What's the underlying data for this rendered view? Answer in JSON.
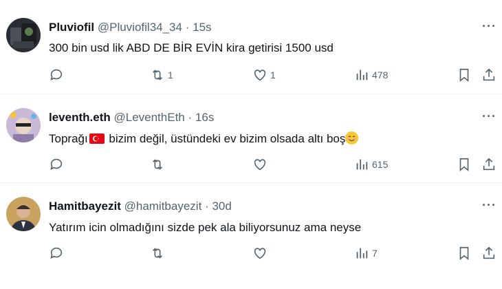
{
  "tweets": [
    {
      "name": "Pluviofil",
      "handle": "@Pluviofil34_34",
      "time": "15s",
      "text": "300 bin usd lik ABD DE BİR EVİN kira getirisi 1500 usd",
      "replies": "",
      "retweets": "1",
      "likes": "1",
      "views": "478"
    },
    {
      "name": "leventh.eth",
      "handle": "@LeventhEth",
      "time": "16s",
      "text_before": "Toprağı",
      "text_after": " bizim değil, üstündeki ev bizim olsada altı boş",
      "replies": "",
      "retweets": "",
      "likes": "",
      "views": "615"
    },
    {
      "name": "Hamitbayezit",
      "handle": "@hamitbayezit",
      "time": "30d",
      "text": "Yatırım icin olmadığını sizde pek ala biliyorsunuz ama neyse",
      "replies": "",
      "retweets": "",
      "likes": "",
      "views": "7"
    }
  ],
  "separator": "·",
  "more_label": "···",
  "icons": [
    "reply-icon",
    "retweet-icon",
    "like-icon",
    "views-icon",
    "bookmark-icon",
    "share-icon",
    "more-icon"
  ],
  "colors": {
    "text": "#0f1419",
    "secondary": "#536471",
    "divider": "#eff3f4",
    "flag_red": "#e30a17"
  }
}
